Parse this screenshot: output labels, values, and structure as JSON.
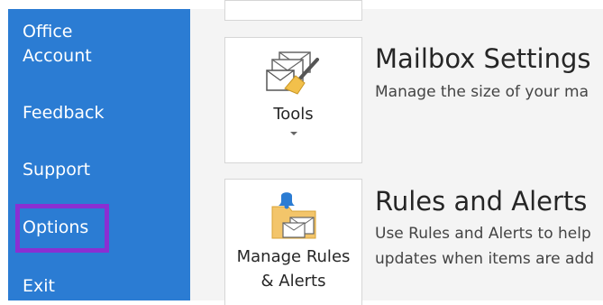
{
  "sidebar": {
    "account_label": "Office\nAccount",
    "account_line1": "Office",
    "account_line2": "Account",
    "feedback_label": "Feedback",
    "support_label": "Support",
    "options_label": "Options",
    "exit_label": "Exit",
    "highlight_color": "#8a2fd2",
    "background_color": "#2b7cd3"
  },
  "tools": {
    "label": "Tools",
    "icon": "tools-envelope-brush-icon"
  },
  "mailbox": {
    "title": "Mailbox Settings",
    "description": "Manage the size of your ma"
  },
  "rules": {
    "label_line1": "Manage Rules",
    "label_line2": "& Alerts",
    "icon": "rules-bell-folder-icon",
    "title": "Rules and Alerts",
    "description_line1": "Use Rules and Alerts to help",
    "description_line2": "updates when items are add"
  }
}
